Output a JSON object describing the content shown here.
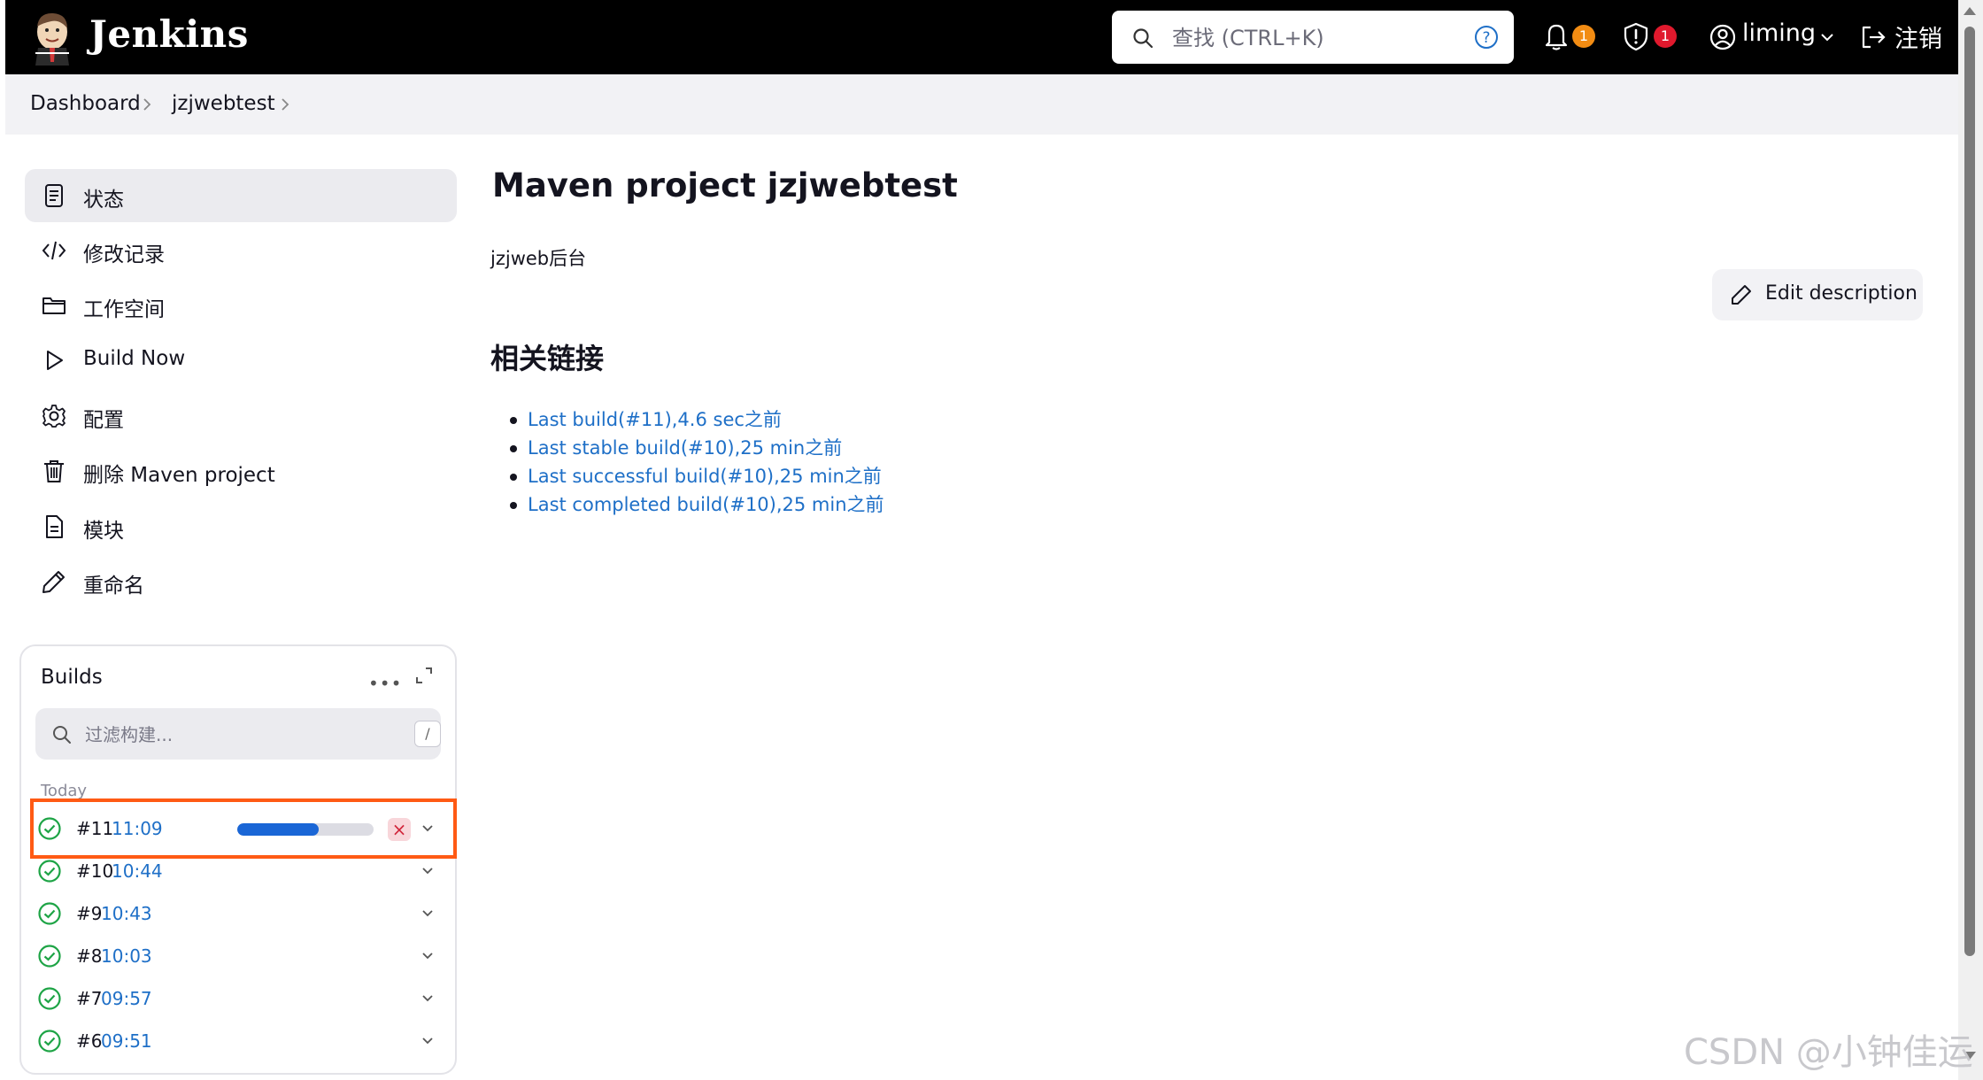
{
  "header": {
    "brand": "Jenkins",
    "search_placeholder": "查找 (CTRL+K)",
    "notifications_count": "1",
    "security_count": "1",
    "user": "liming",
    "logout": "注销"
  },
  "breadcrumb": [
    "Dashboard",
    "jzjwebtest"
  ],
  "sidebar": {
    "items": [
      {
        "label": "状态",
        "icon": "document-icon"
      },
      {
        "label": "修改记录",
        "icon": "code-icon"
      },
      {
        "label": "工作空间",
        "icon": "folder-icon"
      },
      {
        "label": "Build Now",
        "icon": "play-icon"
      },
      {
        "label": "配置",
        "icon": "gear-icon"
      },
      {
        "label": "删除 Maven project",
        "icon": "trash-icon"
      },
      {
        "label": "模块",
        "icon": "file-icon"
      },
      {
        "label": "重命名",
        "icon": "pencil-icon"
      }
    ]
  },
  "builds": {
    "title": "Builds",
    "filter_placeholder": "过滤构建...",
    "filter_shortcut": "/",
    "group": "Today",
    "rows": [
      {
        "number": "#11",
        "time": "11:09",
        "in_progress": true,
        "progress": 0.6
      },
      {
        "number": "#10",
        "time": "10:44"
      },
      {
        "number": "#9",
        "time": "10:43"
      },
      {
        "number": "#8",
        "time": "10:03"
      },
      {
        "number": "#7",
        "time": "09:57"
      },
      {
        "number": "#6",
        "time": "09:51"
      }
    ]
  },
  "main": {
    "title": "Maven project jzjwebtest",
    "description": "jzjweb后台",
    "edit_description": "Edit description",
    "links_heading": "相关链接",
    "links": [
      "Last build(#11),4.6 sec之前",
      "Last stable build(#10),25 min之前",
      "Last successful build(#10),25 min之前",
      "Last completed build(#10),25 min之前"
    ]
  },
  "watermark": "CSDN @小钟佳运",
  "colors": {
    "header_bg": "#000000",
    "link": "#1e6fc7",
    "notification_badge": "#f28c13",
    "security_badge": "#e0192d",
    "success": "#1ea446",
    "highlight": "#ff5a14"
  }
}
